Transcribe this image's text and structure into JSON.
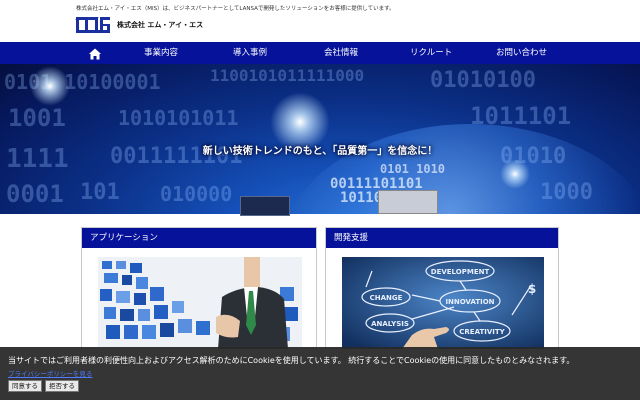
{
  "header": {
    "tagline": "株式会社エム・アイ・エス（MIS）は、ビジネスパートナーとしてLANSAで開発したソリューションをお客様に提供しています。",
    "company_name": "株式会社 エム・アイ・エス",
    "brand_color": "#1a2fa0"
  },
  "nav": {
    "background": "#06129a",
    "home_icon": "home-icon",
    "items": [
      {
        "label": "事業内容"
      },
      {
        "label": "導入事例"
      },
      {
        "label": "会社情報"
      },
      {
        "label": "リクルート"
      },
      {
        "label": "お問い合わせ"
      }
    ]
  },
  "hero": {
    "caption": "新しい技術トレンドのもと、「品質第一」を信念に！"
  },
  "cards": [
    {
      "title": "アプリケーション"
    },
    {
      "title": "開発支援"
    }
  ],
  "cookie": {
    "message": "当サイトではご利用者様の利便性向上およびアクセス解析のためにCookieを使用しています。 続行することでCookieの使用に同意したものとみなされます。",
    "policy_link": "プライバシーポリシーを見る",
    "accept_label": "同意する",
    "reject_label": "拒否する"
  }
}
